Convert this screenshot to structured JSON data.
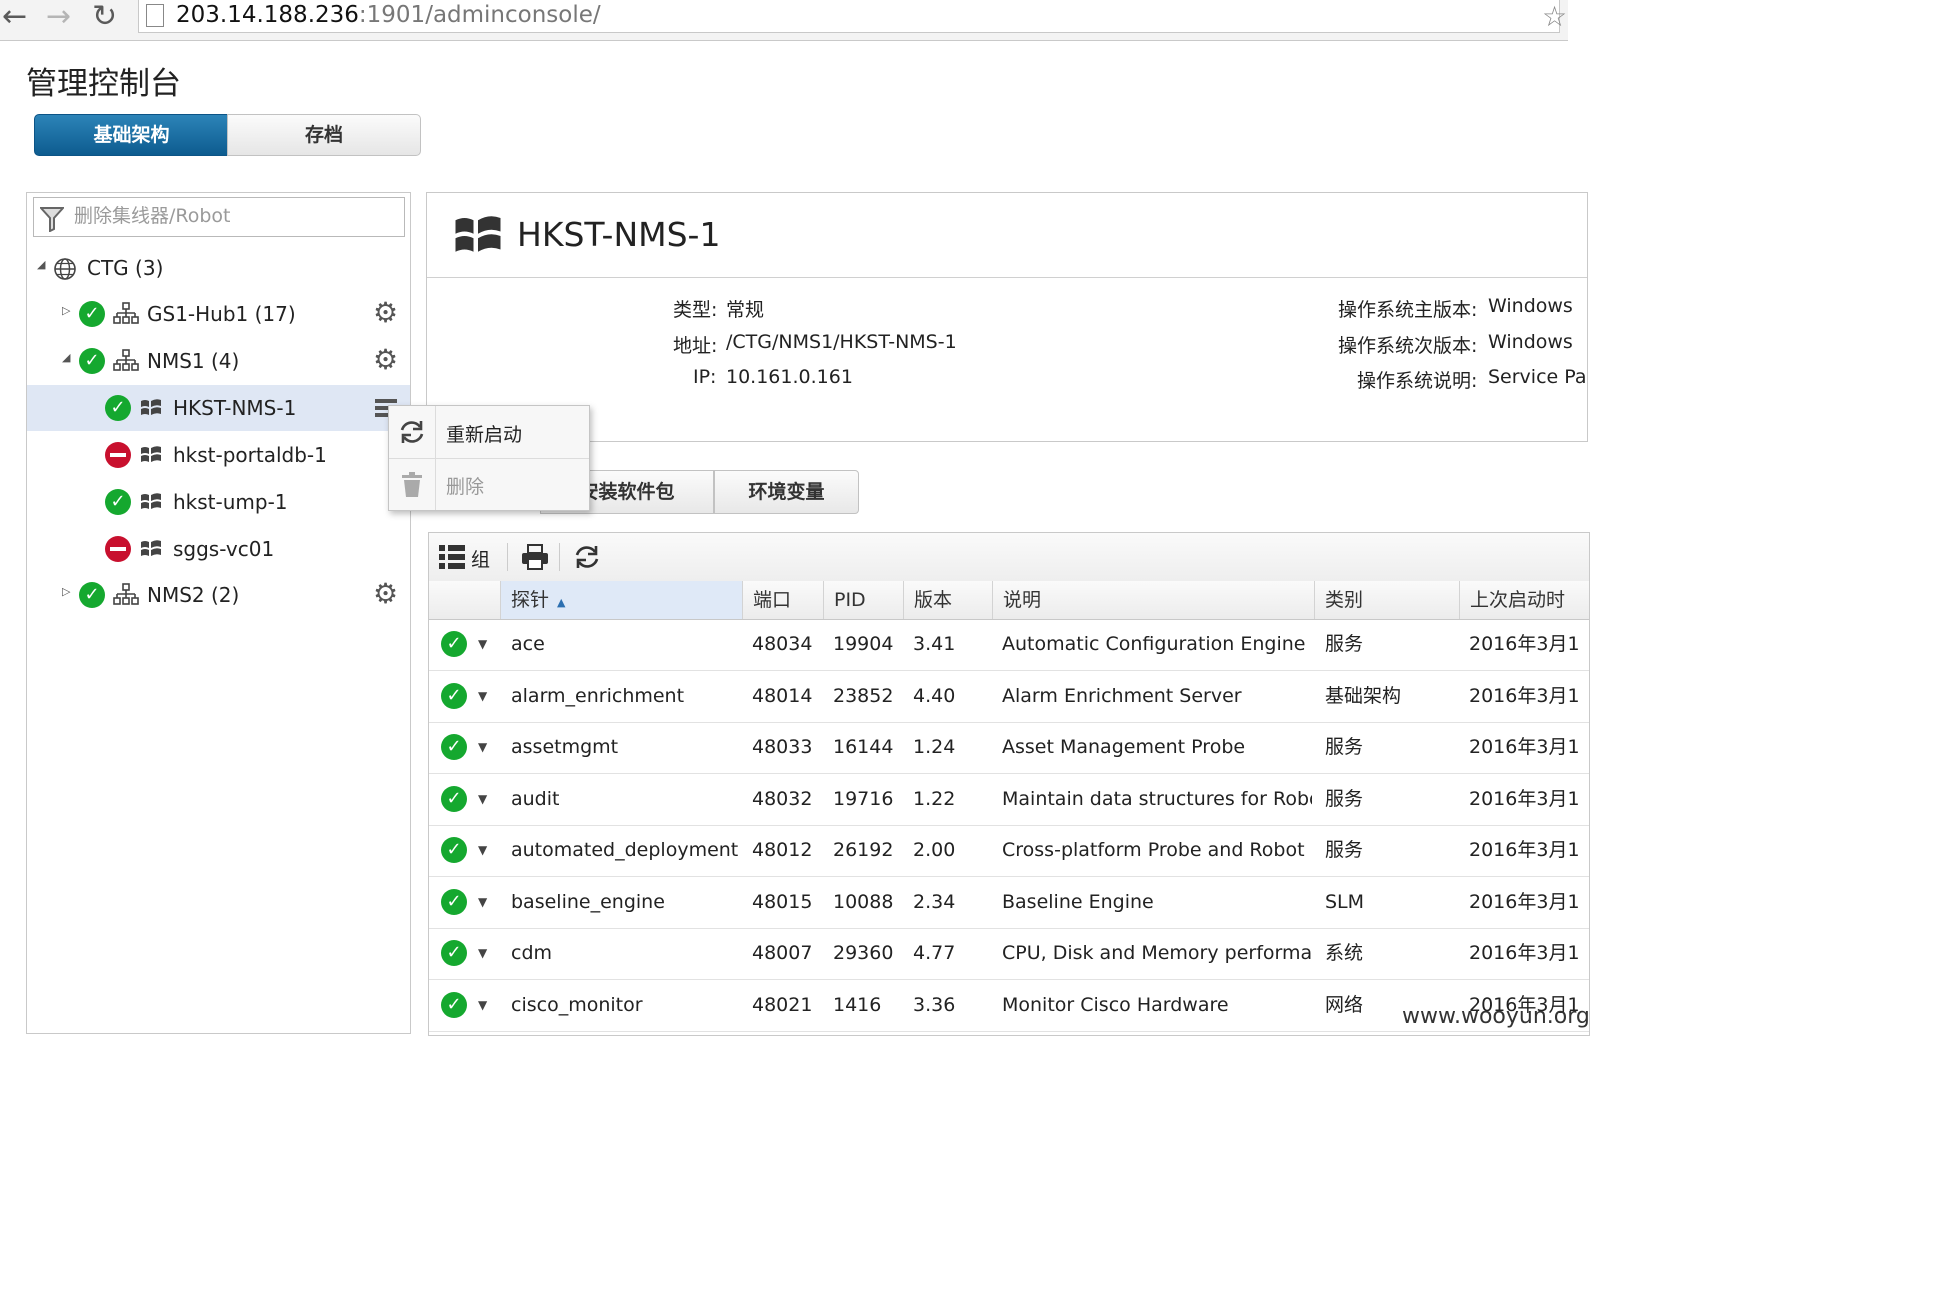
{
  "browser": {
    "back_icon": "←",
    "forward_icon": "→",
    "reload_icon": "↻",
    "url_host": "203.14.188.236",
    "url_rest": ":1901/adminconsole/",
    "star_icon": "☆"
  },
  "page": {
    "title": "管理控制台"
  },
  "tabs": {
    "infrastructure": "基础架构",
    "archive": "存档"
  },
  "tree": {
    "filter_placeholder": "删除集线器/Robot",
    "root": {
      "label": "CTG (3)"
    },
    "hubs": [
      {
        "label": "GS1-Hub1 (17)"
      },
      {
        "label": "NMS1 (4)"
      },
      {
        "label": "NMS2 (2)"
      }
    ],
    "robots": [
      {
        "label": "HKST-NMS-1",
        "status": "ok"
      },
      {
        "label": "hkst-portaldb-1",
        "status": "error"
      },
      {
        "label": "hkst-ump-1",
        "status": "ok"
      },
      {
        "label": "sggs-vc01",
        "status": "error"
      }
    ]
  },
  "context_menu": {
    "restart": "重新启动",
    "delete": "删除"
  },
  "robot": {
    "name": "HKST-NMS-1",
    "type_label": "类型:",
    "type_value": "常规",
    "address_label": "地址:",
    "address_value": "/CTG/NMS1/HKST-NMS-1",
    "ip_label": "IP:",
    "ip_value": "10.161.0.161",
    "os_major_label": "操作系统主版本:",
    "os_major_value": "Windows",
    "os_minor_label": "操作系统次版本:",
    "os_minor_value": "Windows",
    "os_desc_label": "操作系统说明:",
    "os_desc_value": "Service Pa"
  },
  "subtabs": {
    "install": "安装软件包",
    "env": "环境变量"
  },
  "grid": {
    "group_label": "组",
    "columns": [
      "探针",
      "端口",
      "PID",
      "版本",
      "说明",
      "类别",
      "上次启动时"
    ],
    "rows": [
      {
        "probe": "ace",
        "port": "48034",
        "pid": "19904",
        "version": "3.41",
        "desc": "Automatic Configuration Engine",
        "category": "服务",
        "started": "2016年3月1"
      },
      {
        "probe": "alarm_enrichment",
        "port": "48014",
        "pid": "23852",
        "version": "4.40",
        "desc": "Alarm Enrichment Server",
        "category": "基础架构",
        "started": "2016年3月1"
      },
      {
        "probe": "assetmgmt",
        "port": "48033",
        "pid": "16144",
        "version": "1.24",
        "desc": "Asset Management Probe",
        "category": "服务",
        "started": "2016年3月1"
      },
      {
        "probe": "audit",
        "port": "48032",
        "pid": "19716",
        "version": "1.22",
        "desc": "Maintain data structures for Robo...",
        "category": "服务",
        "started": "2016年3月1"
      },
      {
        "probe": "automated_deployment...",
        "port": "48012",
        "pid": "26192",
        "version": "2.00",
        "desc": "Cross-platform Probe and Robot D...",
        "category": "服务",
        "started": "2016年3月1"
      },
      {
        "probe": "baseline_engine",
        "port": "48015",
        "pid": "10088",
        "version": "2.34",
        "desc": "Baseline Engine",
        "category": "SLM",
        "started": "2016年3月1"
      },
      {
        "probe": "cdm",
        "port": "48007",
        "pid": "29360",
        "version": "4.77",
        "desc": "CPU, Disk and Memory performan...",
        "category": "系统",
        "started": "2016年3月1"
      },
      {
        "probe": "cisco_monitor",
        "port": "48021",
        "pid": "1416",
        "version": "3.36",
        "desc": "Monitor Cisco Hardware",
        "category": "网络",
        "started": "2016年3月1"
      }
    ]
  },
  "watermark": "www.wooyun.org",
  "colors": {
    "accent": "#0d5c8f",
    "ok": "#15a82f",
    "error": "#c8102e",
    "selection": "#dfe7f4"
  }
}
